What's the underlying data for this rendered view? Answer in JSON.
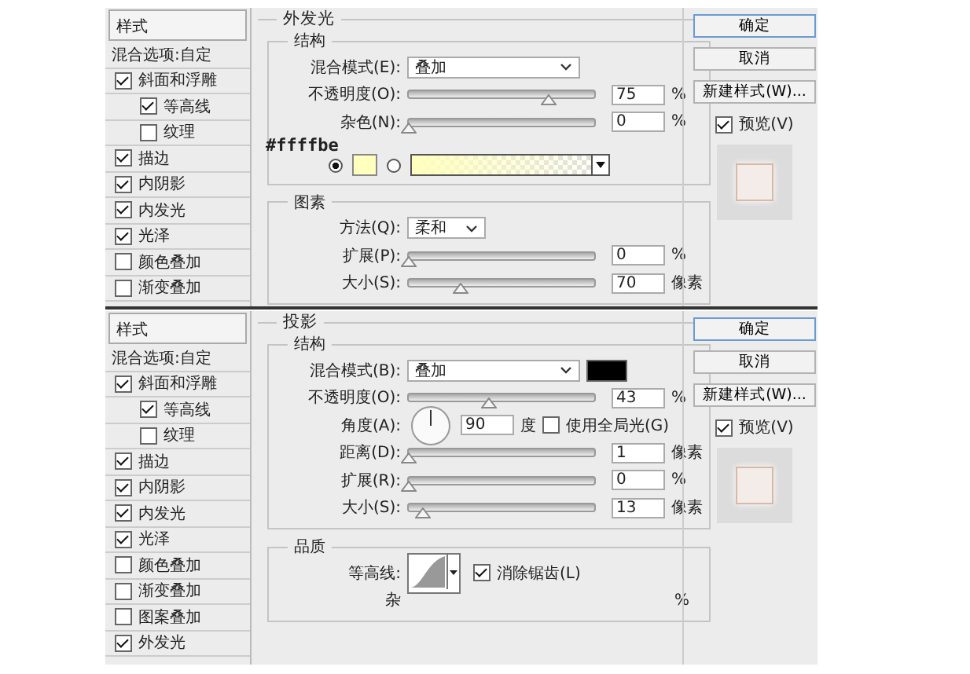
{
  "dialogs": [
    {
      "styles_header": "样式",
      "blend_options": "混合选项:自定",
      "style_items": [
        {
          "label": "斜面和浮雕",
          "checked": true,
          "children": [
            {
              "label": "等高线",
              "checked": true
            },
            {
              "label": "纹理",
              "checked": false
            }
          ]
        },
        {
          "label": "描边",
          "checked": true
        },
        {
          "label": "内阴影",
          "checked": true
        },
        {
          "label": "内发光",
          "checked": true
        },
        {
          "label": "光泽",
          "checked": true
        },
        {
          "label": "颜色叠加",
          "checked": false
        },
        {
          "label": "渐变叠加",
          "checked": false
        }
      ],
      "section_title": "外发光",
      "groups": [
        {
          "title": "结构",
          "rows": [
            {
              "kind": "select",
              "label": "混合模式(E):",
              "value": "叠加"
            },
            {
              "kind": "slider",
              "label": "不透明度(O):",
              "level": 0.75,
              "value": "75",
              "unit": "%"
            },
            {
              "kind": "slider",
              "label": "杂色(N):",
              "level": 0,
              "value": "0",
              "unit": "%"
            },
            {
              "kind": "color",
              "note": "#ffffbe",
              "radios": [
                {
                  "selected": true,
                  "color": "#ffffbe"
                },
                {
                  "selected": false,
                  "color": "#ffffbe"
                }
              ]
            }
          ]
        },
        {
          "title": "图素",
          "rows": [
            {
              "kind": "smallselect",
              "label": "方法(Q):",
              "value": "柔和"
            },
            {
              "kind": "slider",
              "label": "扩展(P):",
              "level": 0,
              "value": "0",
              "unit": "%"
            },
            {
              "kind": "slider",
              "label": "大小(S):",
              "level": 0.28,
              "value": "70",
              "unit": "像素"
            }
          ]
        }
      ],
      "buttons": [
        {
          "label": "确定",
          "default": true
        },
        {
          "label": "取消",
          "default": false
        },
        {
          "label": "新建样式(W)...",
          "default": false
        }
      ],
      "preview": {
        "label": "预览(V)",
        "checked": true
      }
    },
    {
      "styles_header": "样式",
      "blend_options": "混合选项:自定",
      "style_items": [
        {
          "label": "斜面和浮雕",
          "checked": true,
          "children": [
            {
              "label": "等高线",
              "checked": true
            },
            {
              "label": "纹理",
              "checked": false
            }
          ]
        },
        {
          "label": "描边",
          "checked": true
        },
        {
          "label": "内阴影",
          "checked": true
        },
        {
          "label": "内发光",
          "checked": true
        },
        {
          "label": "光泽",
          "checked": true
        },
        {
          "label": "颜色叠加",
          "checked": false
        },
        {
          "label": "渐变叠加",
          "checked": false
        },
        {
          "label": "图案叠加",
          "checked": false
        },
        {
          "label": "外发光",
          "checked": true
        }
      ],
      "section_title": "投影",
      "groups": [
        {
          "title": "结构",
          "rows": [
            {
              "kind": "select",
              "label": "混合模式(B):",
              "value": "叠加",
              "color": "#000000"
            },
            {
              "kind": "slider",
              "label": "不透明度(O):",
              "level": 0.43,
              "value": "43",
              "unit": "%"
            },
            {
              "kind": "angle",
              "label": "角度(A):",
              "value": "90",
              "unit": "度",
              "option": {
                "label": "使用全局光(G)",
                "checked": false
              }
            },
            {
              "kind": "slider",
              "label": "距离(D):",
              "level": 0,
              "value": "1",
              "unit": "像素"
            },
            {
              "kind": "slider",
              "label": "扩展(R):",
              "level": 0,
              "value": "0",
              "unit": "%"
            },
            {
              "kind": "slider",
              "label": "大小(S):",
              "level": 0.08,
              "value": "13",
              "unit": "像素"
            }
          ]
        },
        {
          "title": "品质",
          "rows": [
            {
              "kind": "contour",
              "label": "等高线:",
              "option": {
                "label": "消除锯齿(L)",
                "checked": true
              }
            },
            {
              "kind": "partial",
              "label": "杂",
              "unit": "%"
            }
          ]
        }
      ],
      "buttons": [
        {
          "label": "确定",
          "default": true
        },
        {
          "label": "取消",
          "default": false
        },
        {
          "label": "新建样式(W)...",
          "default": false
        }
      ],
      "preview": {
        "label": "预览(V)",
        "checked": true
      }
    }
  ]
}
